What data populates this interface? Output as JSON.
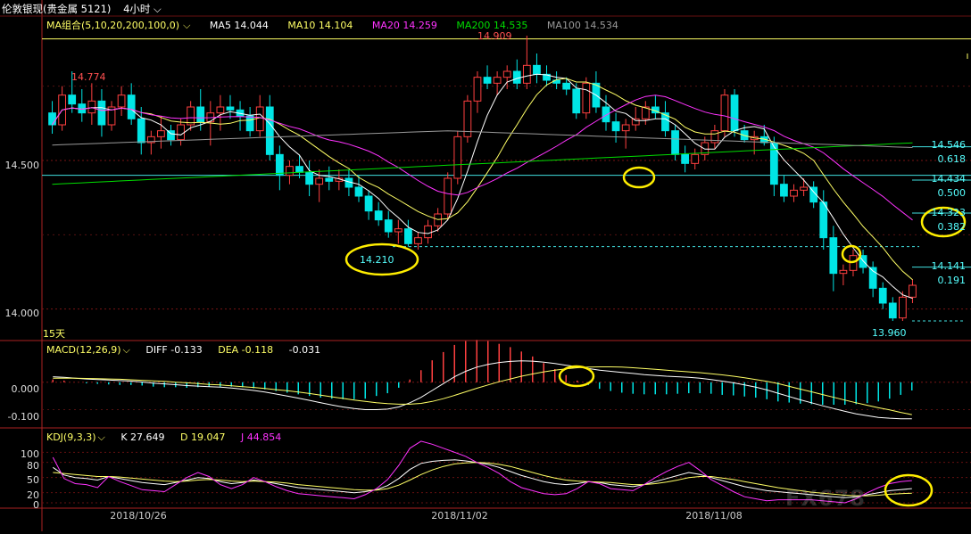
{
  "header": {
    "title": "伦敦银现(贵金属 5121)",
    "period": "4小时",
    "ma_label": "MA组合(5,10,20,200,100,0)",
    "ma5": "MA5 14.044",
    "ma10": "MA10 14.104",
    "ma20": "MA20 14.259",
    "ma200": "MA200 14.535",
    "ma100": "MA100 14.534"
  },
  "macd_header": {
    "label": "MACD(12,26,9)",
    "diff": "DIFF -0.133",
    "dea": "DEA -0.118",
    "macd": "-0.031"
  },
  "kdj_header": {
    "label": "KDJ(9,3,3)",
    "k": "K 27.649",
    "d": "D 19.047",
    "j": "J 44.854"
  },
  "axes": {
    "price_ticks": [
      "14.500",
      "14.000"
    ],
    "macd_ticks": [
      "0.000",
      "-0.100"
    ],
    "kdj_ticks": [
      "100",
      "80",
      "50",
      "20",
      "0"
    ],
    "x_ticks": [
      "2018/10/26",
      "2018/11/02",
      "2018/11/08"
    ],
    "range_label": "15天"
  },
  "annotations": {
    "high": "14.909",
    "left_high": "14.774",
    "low_mark": "14.210",
    "final_low": "13.960"
  },
  "fib_levels": [
    {
      "price": "14.546",
      "ratio": "0.618"
    },
    {
      "price": "14.434",
      "ratio": "0.500"
    },
    {
      "price": "14.323",
      "ratio": "0.382"
    },
    {
      "price": "14.141",
      "ratio": "0.191"
    }
  ],
  "watermark": "FX678",
  "colors": {
    "up": "#ff4040",
    "down": "#00e5e5",
    "ma5": "#ffffff",
    "ma10": "#ffff66",
    "ma20": "#ff33ff",
    "ma200": "#00dd00",
    "ma100": "#999999",
    "circle": "#ffee00"
  },
  "chart_data": {
    "type": "candlestick",
    "x_dates": [
      "2018/10/26",
      "2018/11/02",
      "2018/11/08"
    ],
    "ylim": [
      13.9,
      14.92
    ],
    "candles": [
      [
        14.66,
        14.7,
        14.59,
        14.62
      ],
      [
        14.62,
        14.75,
        14.6,
        14.72
      ],
      [
        14.72,
        14.8,
        14.66,
        14.69
      ],
      [
        14.69,
        14.74,
        14.63,
        14.66
      ],
      [
        14.66,
        14.76,
        14.62,
        14.7
      ],
      [
        14.7,
        14.74,
        14.58,
        14.62
      ],
      [
        14.62,
        14.7,
        14.6,
        14.68
      ],
      [
        14.68,
        14.75,
        14.65,
        14.72
      ],
      [
        14.72,
        14.76,
        14.62,
        14.64
      ],
      [
        14.64,
        14.68,
        14.52,
        14.56
      ],
      [
        14.56,
        14.6,
        14.52,
        14.58
      ],
      [
        14.58,
        14.65,
        14.54,
        14.6
      ],
      [
        14.6,
        14.62,
        14.55,
        14.57
      ],
      [
        14.57,
        14.64,
        14.55,
        14.62
      ],
      [
        14.62,
        14.7,
        14.6,
        14.68
      ],
      [
        14.68,
        14.74,
        14.6,
        14.63
      ],
      [
        14.63,
        14.7,
        14.55,
        14.66
      ],
      [
        14.66,
        14.72,
        14.6,
        14.68
      ],
      [
        14.68,
        14.72,
        14.64,
        14.67
      ],
      [
        14.67,
        14.7,
        14.6,
        14.65
      ],
      [
        14.65,
        14.68,
        14.58,
        14.6
      ],
      [
        14.6,
        14.72,
        14.58,
        14.68
      ],
      [
        14.68,
        14.72,
        14.5,
        14.52
      ],
      [
        14.52,
        14.55,
        14.4,
        14.45
      ],
      [
        14.45,
        14.5,
        14.42,
        14.48
      ],
      [
        14.48,
        14.52,
        14.44,
        14.46
      ],
      [
        14.46,
        14.5,
        14.38,
        14.42
      ],
      [
        14.42,
        14.47,
        14.36,
        14.44
      ],
      [
        14.44,
        14.48,
        14.4,
        14.43
      ],
      [
        14.43,
        14.47,
        14.4,
        14.44
      ],
      [
        14.44,
        14.47,
        14.38,
        14.41
      ],
      [
        14.41,
        14.45,
        14.36,
        14.38
      ],
      [
        14.38,
        14.4,
        14.3,
        14.33
      ],
      [
        14.33,
        14.36,
        14.28,
        14.3
      ],
      [
        14.3,
        14.33,
        14.24,
        14.26
      ],
      [
        14.26,
        14.3,
        14.22,
        14.27
      ],
      [
        14.27,
        14.3,
        14.21,
        14.22
      ],
      [
        14.22,
        14.26,
        14.2,
        14.24
      ],
      [
        14.24,
        14.3,
        14.22,
        14.28
      ],
      [
        14.28,
        14.34,
        14.26,
        14.32
      ],
      [
        14.32,
        14.46,
        14.3,
        14.44
      ],
      [
        14.44,
        14.6,
        14.42,
        14.58
      ],
      [
        14.58,
        14.72,
        14.56,
        14.7
      ],
      [
        14.7,
        14.8,
        14.66,
        14.78
      ],
      [
        14.78,
        14.82,
        14.74,
        14.76
      ],
      [
        14.76,
        14.8,
        14.72,
        14.78
      ],
      [
        14.78,
        14.82,
        14.74,
        14.8
      ],
      [
        14.8,
        14.84,
        14.74,
        14.76
      ],
      [
        14.76,
        14.92,
        14.74,
        14.82
      ],
      [
        14.82,
        14.86,
        14.76,
        14.79
      ],
      [
        14.79,
        14.82,
        14.75,
        14.77
      ],
      [
        14.77,
        14.8,
        14.74,
        14.76
      ],
      [
        14.76,
        14.78,
        14.72,
        14.74
      ],
      [
        14.74,
        14.76,
        14.64,
        14.66
      ],
      [
        14.66,
        14.78,
        14.64,
        14.76
      ],
      [
        14.76,
        14.8,
        14.66,
        14.68
      ],
      [
        14.68,
        14.72,
        14.6,
        14.63
      ],
      [
        14.63,
        14.66,
        14.56,
        14.6
      ],
      [
        14.6,
        14.64,
        14.54,
        14.62
      ],
      [
        14.62,
        14.68,
        14.6,
        14.64
      ],
      [
        14.64,
        14.7,
        14.62,
        14.68
      ],
      [
        14.68,
        14.72,
        14.64,
        14.66
      ],
      [
        14.66,
        14.7,
        14.58,
        14.6
      ],
      [
        14.6,
        14.62,
        14.5,
        14.52
      ],
      [
        14.52,
        14.55,
        14.46,
        14.49
      ],
      [
        14.49,
        14.54,
        14.47,
        14.52
      ],
      [
        14.52,
        14.58,
        14.5,
        14.56
      ],
      [
        14.56,
        14.62,
        14.54,
        14.6
      ],
      [
        14.6,
        14.74,
        14.58,
        14.72
      ],
      [
        14.72,
        14.74,
        14.58,
        14.6
      ],
      [
        14.6,
        14.62,
        14.56,
        14.57
      ],
      [
        14.57,
        14.6,
        14.52,
        14.58
      ],
      [
        14.58,
        14.62,
        14.55,
        14.56
      ],
      [
        14.56,
        14.58,
        14.38,
        14.42
      ],
      [
        14.42,
        14.45,
        14.36,
        14.38
      ],
      [
        14.38,
        14.42,
        14.36,
        14.4
      ],
      [
        14.4,
        14.44,
        14.38,
        14.41
      ],
      [
        14.41,
        14.43,
        14.34,
        14.36
      ],
      [
        14.36,
        14.4,
        14.2,
        14.24
      ],
      [
        14.24,
        14.28,
        14.06,
        14.12
      ],
      [
        14.12,
        14.15,
        14.08,
        14.13
      ],
      [
        14.13,
        14.2,
        14.11,
        14.18
      ],
      [
        14.18,
        14.2,
        14.12,
        14.14
      ],
      [
        14.14,
        14.16,
        14.04,
        14.07
      ],
      [
        14.07,
        14.09,
        14.0,
        14.02
      ],
      [
        14.02,
        14.04,
        13.96,
        13.97
      ],
      [
        13.97,
        14.06,
        13.96,
        14.04
      ],
      [
        14.04,
        14.1,
        14.02,
        14.08
      ]
    ],
    "macd": {
      "diff": [
        0.02,
        0.018,
        0.015,
        0.012,
        0.01,
        0.008,
        0.006,
        0.004,
        0.001,
        -0.003,
        -0.006,
        -0.009,
        -0.012,
        -0.014,
        -0.016,
        -0.018,
        -0.021,
        -0.025,
        -0.03,
        -0.036,
        -0.043,
        -0.05,
        -0.058,
        -0.066,
        -0.075,
        -0.083,
        -0.09,
        -0.096,
        -0.1,
        -0.1,
        -0.098,
        -0.09,
        -0.075,
        -0.055,
        -0.03,
        -0.005,
        0.02,
        0.04,
        0.055,
        0.065,
        0.072,
        0.076,
        0.078,
        0.077,
        0.073,
        0.068,
        0.062,
        0.056,
        0.05,
        0.044,
        0.04,
        0.036,
        0.032,
        0.028,
        0.025,
        0.022,
        0.02,
        0.018,
        0.015,
        0.01,
        0.004,
        -0.002,
        -0.01,
        -0.018,
        -0.028,
        -0.04,
        -0.052,
        -0.064,
        -0.075,
        -0.086,
        -0.096,
        -0.106,
        -0.115,
        -0.122,
        -0.128,
        -0.131,
        -0.133,
        -0.133
      ],
      "dea": [
        0.015,
        0.015,
        0.015,
        0.014,
        0.013,
        0.012,
        0.011,
        0.009,
        0.007,
        0.005,
        0.003,
        0.0,
        -0.002,
        -0.005,
        -0.008,
        -0.01,
        -0.013,
        -0.016,
        -0.019,
        -0.023,
        -0.027,
        -0.031,
        -0.036,
        -0.041,
        -0.047,
        -0.053,
        -0.059,
        -0.065,
        -0.07,
        -0.075,
        -0.078,
        -0.08,
        -0.08,
        -0.077,
        -0.07,
        -0.06,
        -0.048,
        -0.035,
        -0.022,
        -0.01,
        0.002,
        0.012,
        0.022,
        0.03,
        0.038,
        0.044,
        0.049,
        0.053,
        0.055,
        0.056,
        0.056,
        0.055,
        0.053,
        0.05,
        0.047,
        0.044,
        0.041,
        0.038,
        0.035,
        0.031,
        0.027,
        0.022,
        0.016,
        0.01,
        0.003,
        -0.005,
        -0.015,
        -0.025,
        -0.035,
        -0.045,
        -0.055,
        -0.065,
        -0.075,
        -0.084,
        -0.093,
        -0.101,
        -0.11,
        -0.118
      ]
    },
    "kdj": {
      "k": [
        70,
        55,
        50,
        48,
        45,
        52,
        48,
        44,
        40,
        38,
        36,
        40,
        45,
        50,
        48,
        42,
        38,
        40,
        45,
        42,
        38,
        34,
        30,
        28,
        26,
        24,
        22,
        20,
        22,
        26,
        34,
        48,
        66,
        78,
        82,
        84,
        85,
        83,
        80,
        76,
        70,
        62,
        54,
        48,
        42,
        38,
        36,
        38,
        42,
        40,
        36,
        34,
        32,
        36,
        42,
        48,
        54,
        60,
        56,
        50,
        44,
        38,
        32,
        28,
        24,
        22,
        20,
        18,
        16,
        14,
        12,
        10,
        12,
        16,
        20,
        24,
        26,
        28
      ],
      "d": [
        60,
        58,
        56,
        54,
        52,
        52,
        51,
        49,
        47,
        45,
        43,
        42,
        43,
        45,
        46,
        45,
        43,
        42,
        43,
        42,
        41,
        39,
        36,
        34,
        32,
        30,
        28,
        26,
        25,
        25,
        28,
        35,
        45,
        56,
        65,
        72,
        77,
        79,
        80,
        79,
        76,
        72,
        66,
        60,
        54,
        49,
        45,
        43,
        42,
        41,
        40,
        38,
        36,
        36,
        38,
        41,
        45,
        50,
        52,
        52,
        49,
        46,
        42,
        38,
        34,
        30,
        27,
        24,
        21,
        19,
        17,
        15,
        14,
        14,
        15,
        17,
        18,
        19
      ],
      "j": [
        90,
        48,
        38,
        36,
        30,
        52,
        42,
        34,
        26,
        24,
        22,
        36,
        50,
        60,
        52,
        36,
        28,
        36,
        50,
        42,
        32,
        24,
        18,
        16,
        14,
        12,
        10,
        8,
        16,
        28,
        46,
        74,
        108,
        122,
        116,
        108,
        100,
        92,
        80,
        70,
        58,
        42,
        30,
        24,
        18,
        16,
        18,
        28,
        42,
        38,
        28,
        26,
        24,
        36,
        50,
        62,
        72,
        80,
        64,
        46,
        34,
        22,
        12,
        8,
        4,
        6,
        6,
        6,
        6,
        4,
        2,
        0,
        8,
        20,
        30,
        38,
        42,
        44
      ]
    }
  }
}
